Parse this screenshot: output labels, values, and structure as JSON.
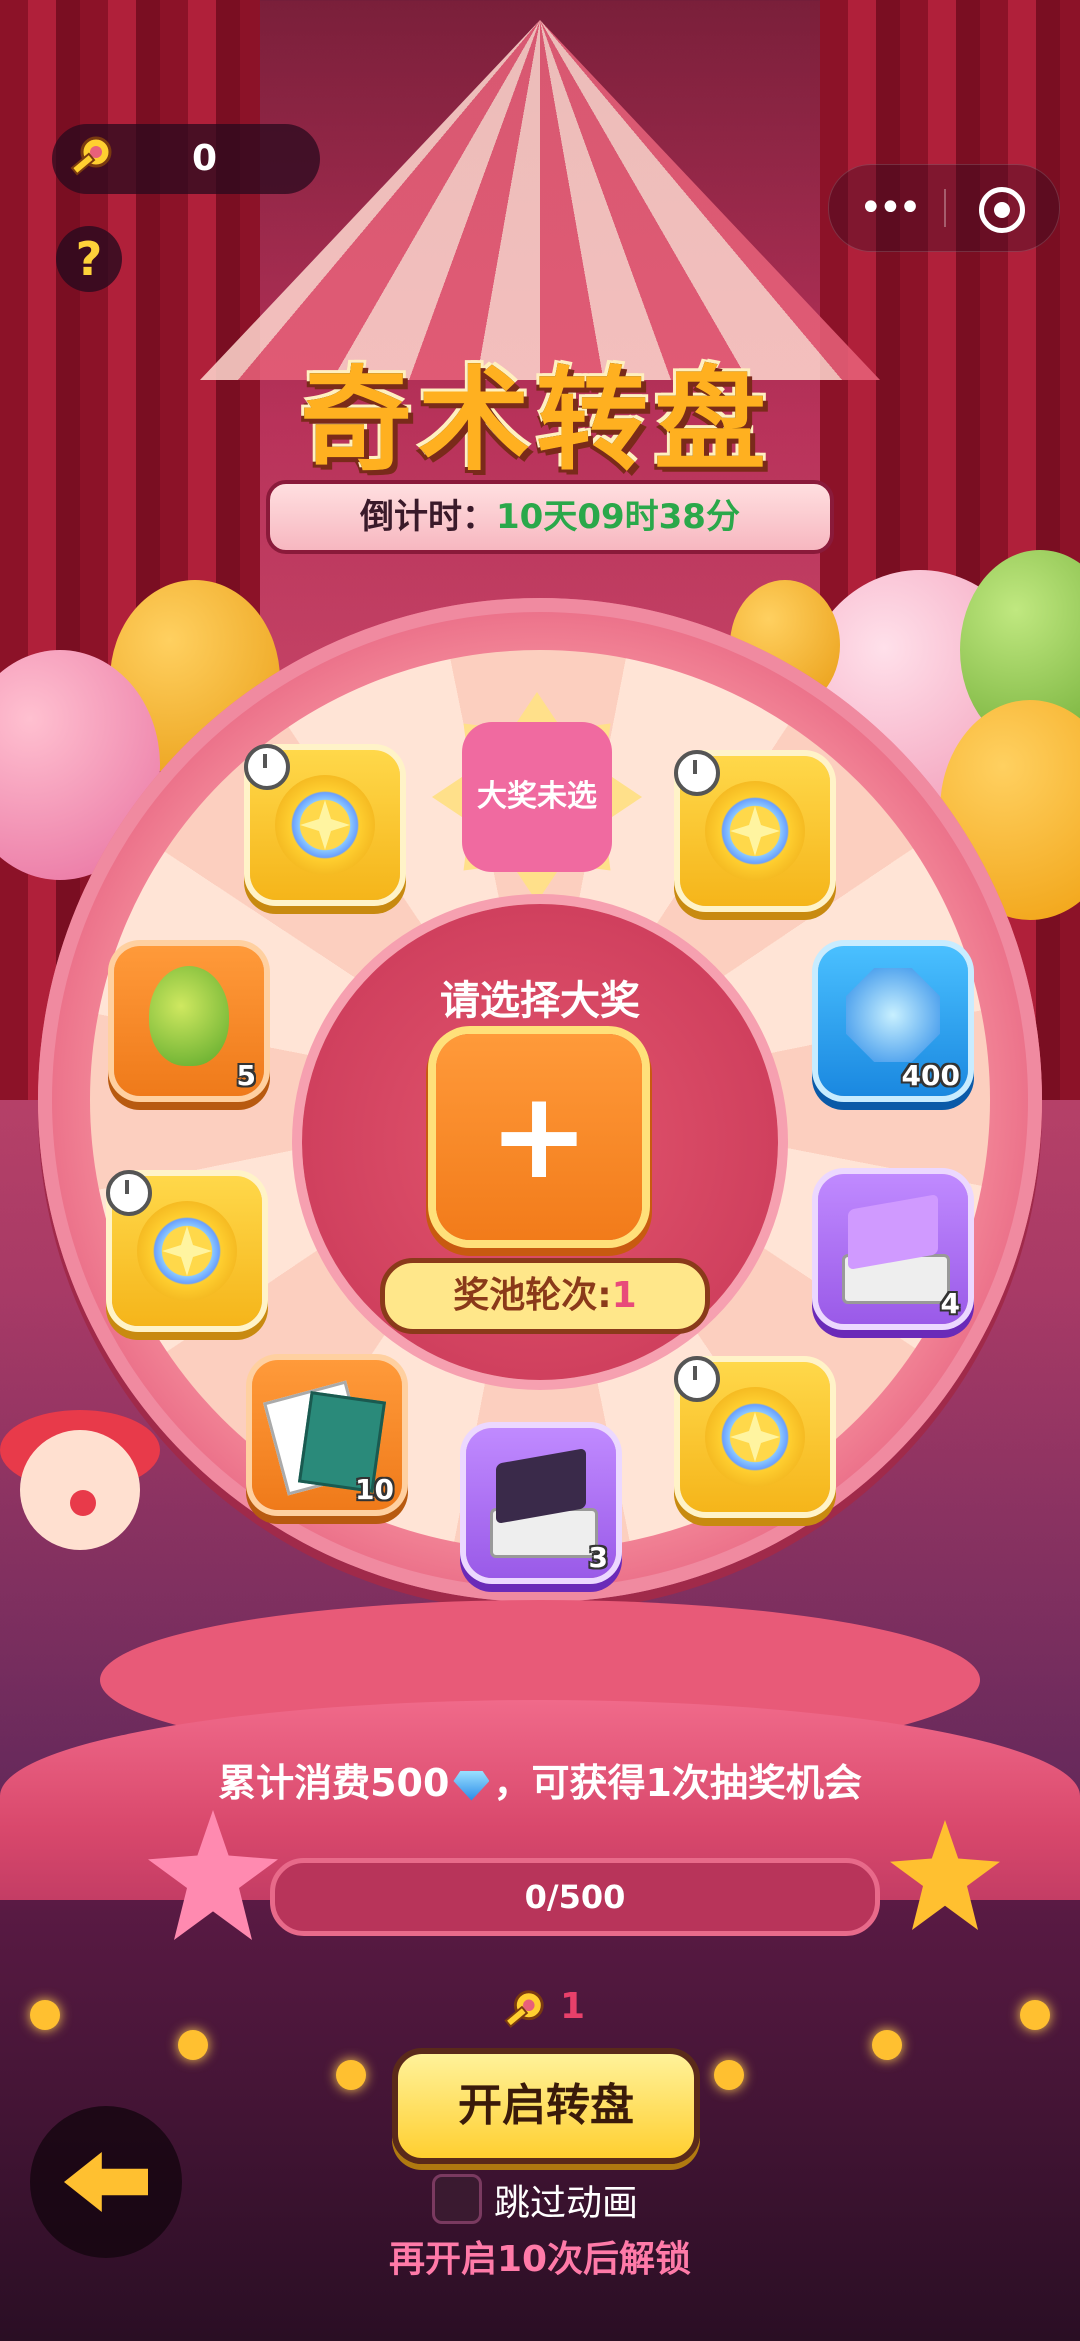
{
  "hud": {
    "key_count": "0",
    "help_icon": "question-icon",
    "key_icon": "key-icon"
  },
  "capsule": {
    "more_icon": "more-dots-icon",
    "close_icon": "target-close-icon"
  },
  "title": {
    "text": "奇术转盘",
    "countdown_label": "倒计时：",
    "countdown_value": "10天09时38分"
  },
  "wheel": {
    "grand_prize_badge": "大奖未选",
    "center_title": "请选择大奖",
    "add_icon": "plus-icon",
    "round_label": "奖池轮次:",
    "round_value": "1",
    "items": [
      {
        "type": "compass",
        "qty": "",
        "timed": true
      },
      {
        "type": "compass",
        "qty": "",
        "timed": true
      },
      {
        "type": "hop",
        "qty": "5",
        "timed": false
      },
      {
        "type": "gem",
        "qty": "400",
        "timed": false
      },
      {
        "type": "compass",
        "qty": "",
        "timed": true
      },
      {
        "type": "purple-cube",
        "qty": "4",
        "timed": false
      },
      {
        "type": "book",
        "qty": "10",
        "timed": false
      },
      {
        "type": "dark-cube",
        "qty": "3",
        "timed": false
      },
      {
        "type": "compass",
        "qty": "",
        "timed": true
      }
    ]
  },
  "progress": {
    "text_before": "累计消费500",
    "text_after": "，可获得1次抽奖机会",
    "value_text": "0/500",
    "fraction": 0
  },
  "actions": {
    "cost_value": "1",
    "start_label": "开启转盘",
    "skip_label": "跳过动画",
    "unlock_text": "再开启10次后解锁",
    "back_icon": "back-arrow-icon"
  },
  "colors": {
    "accent_gold": "#ffcf30",
    "pink": "#e85a78",
    "countdown_green": "#2aa84a"
  }
}
